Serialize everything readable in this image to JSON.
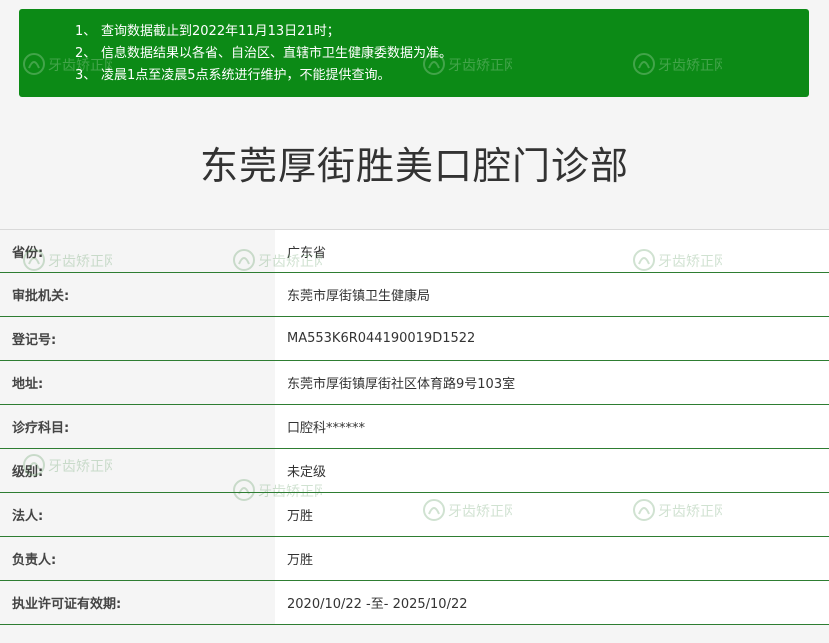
{
  "notice": {
    "items": [
      {
        "num": "1、",
        "text": "查询数据截止到2022年11月13日21时；"
      },
      {
        "num": "2、",
        "text": "信息数据结果以各省、自治区、直辖市卫生健康委数据为准。"
      },
      {
        "num": "3、",
        "text": "凌晨1点至凌晨5点系统进行维护，不能提供查询。"
      }
    ]
  },
  "title": "东莞厚街胜美口腔门诊部",
  "rows": [
    {
      "label": "省份:",
      "value": "广东省"
    },
    {
      "label": "审批机关:",
      "value": "东莞市厚街镇卫生健康局"
    },
    {
      "label": "登记号:",
      "value": "MA553K6R044190019D1522"
    },
    {
      "label": "地址:",
      "value": "东莞市厚街镇厚街社区体育路9号103室"
    },
    {
      "label": "诊疗科目:",
      "value": "口腔科******"
    },
    {
      "label": "级别:",
      "value": "未定级"
    },
    {
      "label": "法人:",
      "value": "万胜"
    },
    {
      "label": "负责人:",
      "value": "万胜"
    },
    {
      "label": "执业许可证有效期:",
      "value": "2020/10/22 -至- 2025/10/22"
    }
  ],
  "watermark": {
    "text": "牙齿矫正网"
  },
  "colors": {
    "notice_bg": "#0c8a16",
    "row_border": "#2e7d32",
    "label_bg": "#f5f5f5",
    "value_bg": "#ffffff"
  }
}
